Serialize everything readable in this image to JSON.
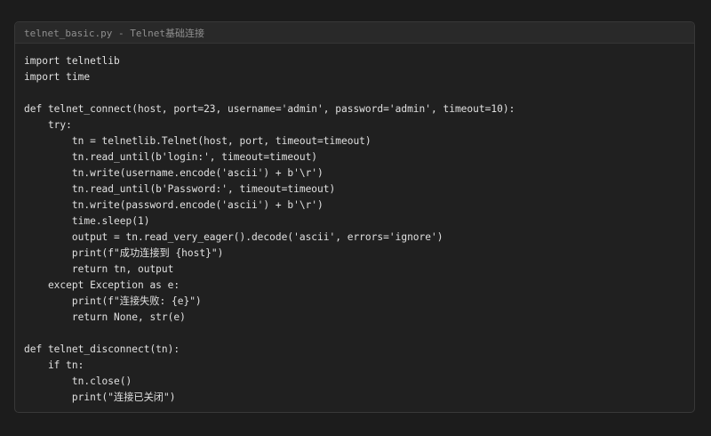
{
  "window": {
    "title": "telnet_basic.py - Telnet基础连接"
  },
  "code": {
    "lines": [
      "import telnetlib",
      "import time",
      "",
      "def telnet_connect(host, port=23, username='admin', password='admin', timeout=10):",
      "    try:",
      "        tn = telnetlib.Telnet(host, port, timeout=timeout)",
      "        tn.read_until(b'login:', timeout=timeout)",
      "        tn.write(username.encode('ascii') + b'\\r')",
      "        tn.read_until(b'Password:', timeout=timeout)",
      "        tn.write(password.encode('ascii') + b'\\r')",
      "        time.sleep(1)",
      "        output = tn.read_very_eager().decode('ascii', errors='ignore')",
      "        print(f\"成功连接到 {host}\")",
      "        return tn, output",
      "    except Exception as e:",
      "        print(f\"连接失败: {e}\")",
      "        return None, str(e)",
      "",
      "def telnet_disconnect(tn):",
      "    if tn:",
      "        tn.close()",
      "        print(\"连接已关闭\")"
    ]
  }
}
